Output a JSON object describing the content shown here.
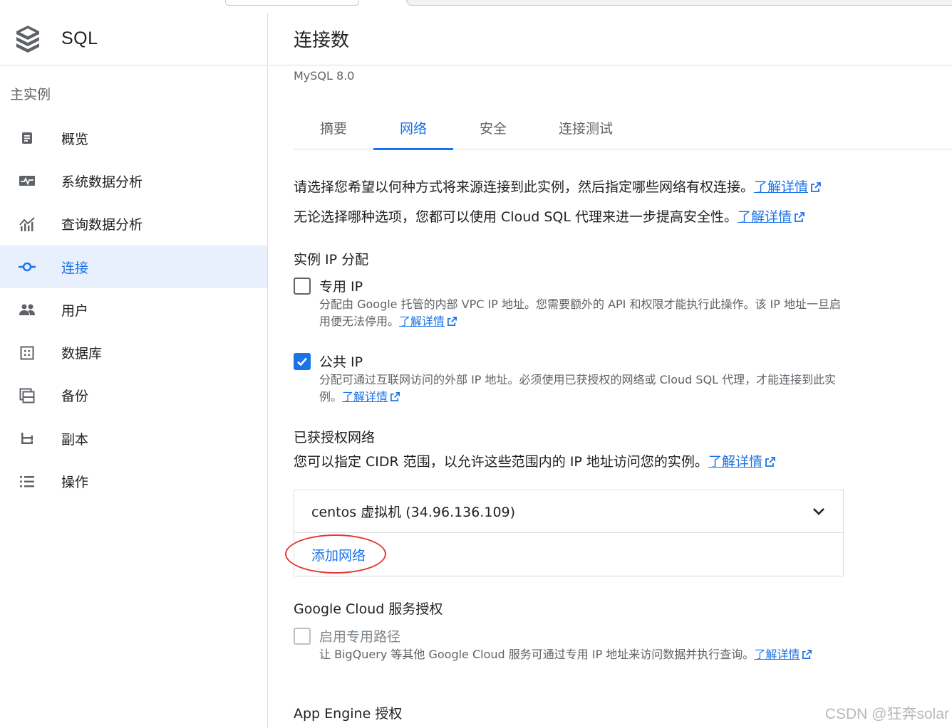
{
  "sidebar": {
    "title": "SQL",
    "section_label": "主实例",
    "items": [
      {
        "label": "概览",
        "icon": "dashboard-icon"
      },
      {
        "label": "系统数据分析",
        "icon": "monitoring-icon"
      },
      {
        "label": "查询数据分析",
        "icon": "insights-icon"
      },
      {
        "label": "连接",
        "icon": "connections-icon",
        "active": true
      },
      {
        "label": "用户",
        "icon": "users-icon"
      },
      {
        "label": "数据库",
        "icon": "database-icon"
      },
      {
        "label": "备份",
        "icon": "backup-icon"
      },
      {
        "label": "副本",
        "icon": "replicas-icon"
      },
      {
        "label": "操作",
        "icon": "operations-icon"
      }
    ]
  },
  "header": {
    "title": "连接数",
    "subtitle": "MySQL 8.0"
  },
  "tabs": [
    {
      "label": "摘要"
    },
    {
      "label": "网络",
      "active": true
    },
    {
      "label": "安全"
    },
    {
      "label": "连接测试"
    }
  ],
  "intro": {
    "line1": "请选择您希望以何种方式将来源连接到此实例，然后指定哪些网络有权连接。",
    "line2": "无论选择哪种选项，您都可以使用 Cloud SQL 代理来进一步提高安全性。",
    "learn_more": "了解详情"
  },
  "ip_assignment": {
    "heading": "实例 IP 分配",
    "private_ip": {
      "label": "专用 IP",
      "checked": false,
      "desc": "分配由 Google 托管的内部 VPC IP 地址。您需要额外的 API 和权限才能执行此操作。该 IP 地址一旦启用便无法停用。"
    },
    "public_ip": {
      "label": "公共 IP",
      "checked": true,
      "desc": "分配可通过互联网访问的外部 IP 地址。必须使用已获授权的网络或 Cloud SQL 代理，才能连接到此实例。"
    }
  },
  "authorized_networks": {
    "heading": "已获授权网络",
    "desc": "您可以指定 CIDR 范围，以允许这些范围内的 IP 地址访问您的实例。",
    "networks": [
      {
        "name": "centos 虚拟机 (34.96.136.109)"
      }
    ],
    "add_label": "添加网络"
  },
  "gc_services": {
    "heading": "Google Cloud 服务授权",
    "private_path": {
      "label": "启用专用路径",
      "checked": false,
      "desc": "让 BigQuery 等其他 Google Cloud 服务可通过专用 IP 地址来访问数据并执行查询。"
    }
  },
  "app_engine": {
    "heading": "App Engine 授权"
  },
  "watermark": "CSDN @狂奔solar",
  "colors": {
    "accent": "#1a73e8",
    "active_bg": "#e8f0fe",
    "highlight_ellipse": "#e53935"
  }
}
